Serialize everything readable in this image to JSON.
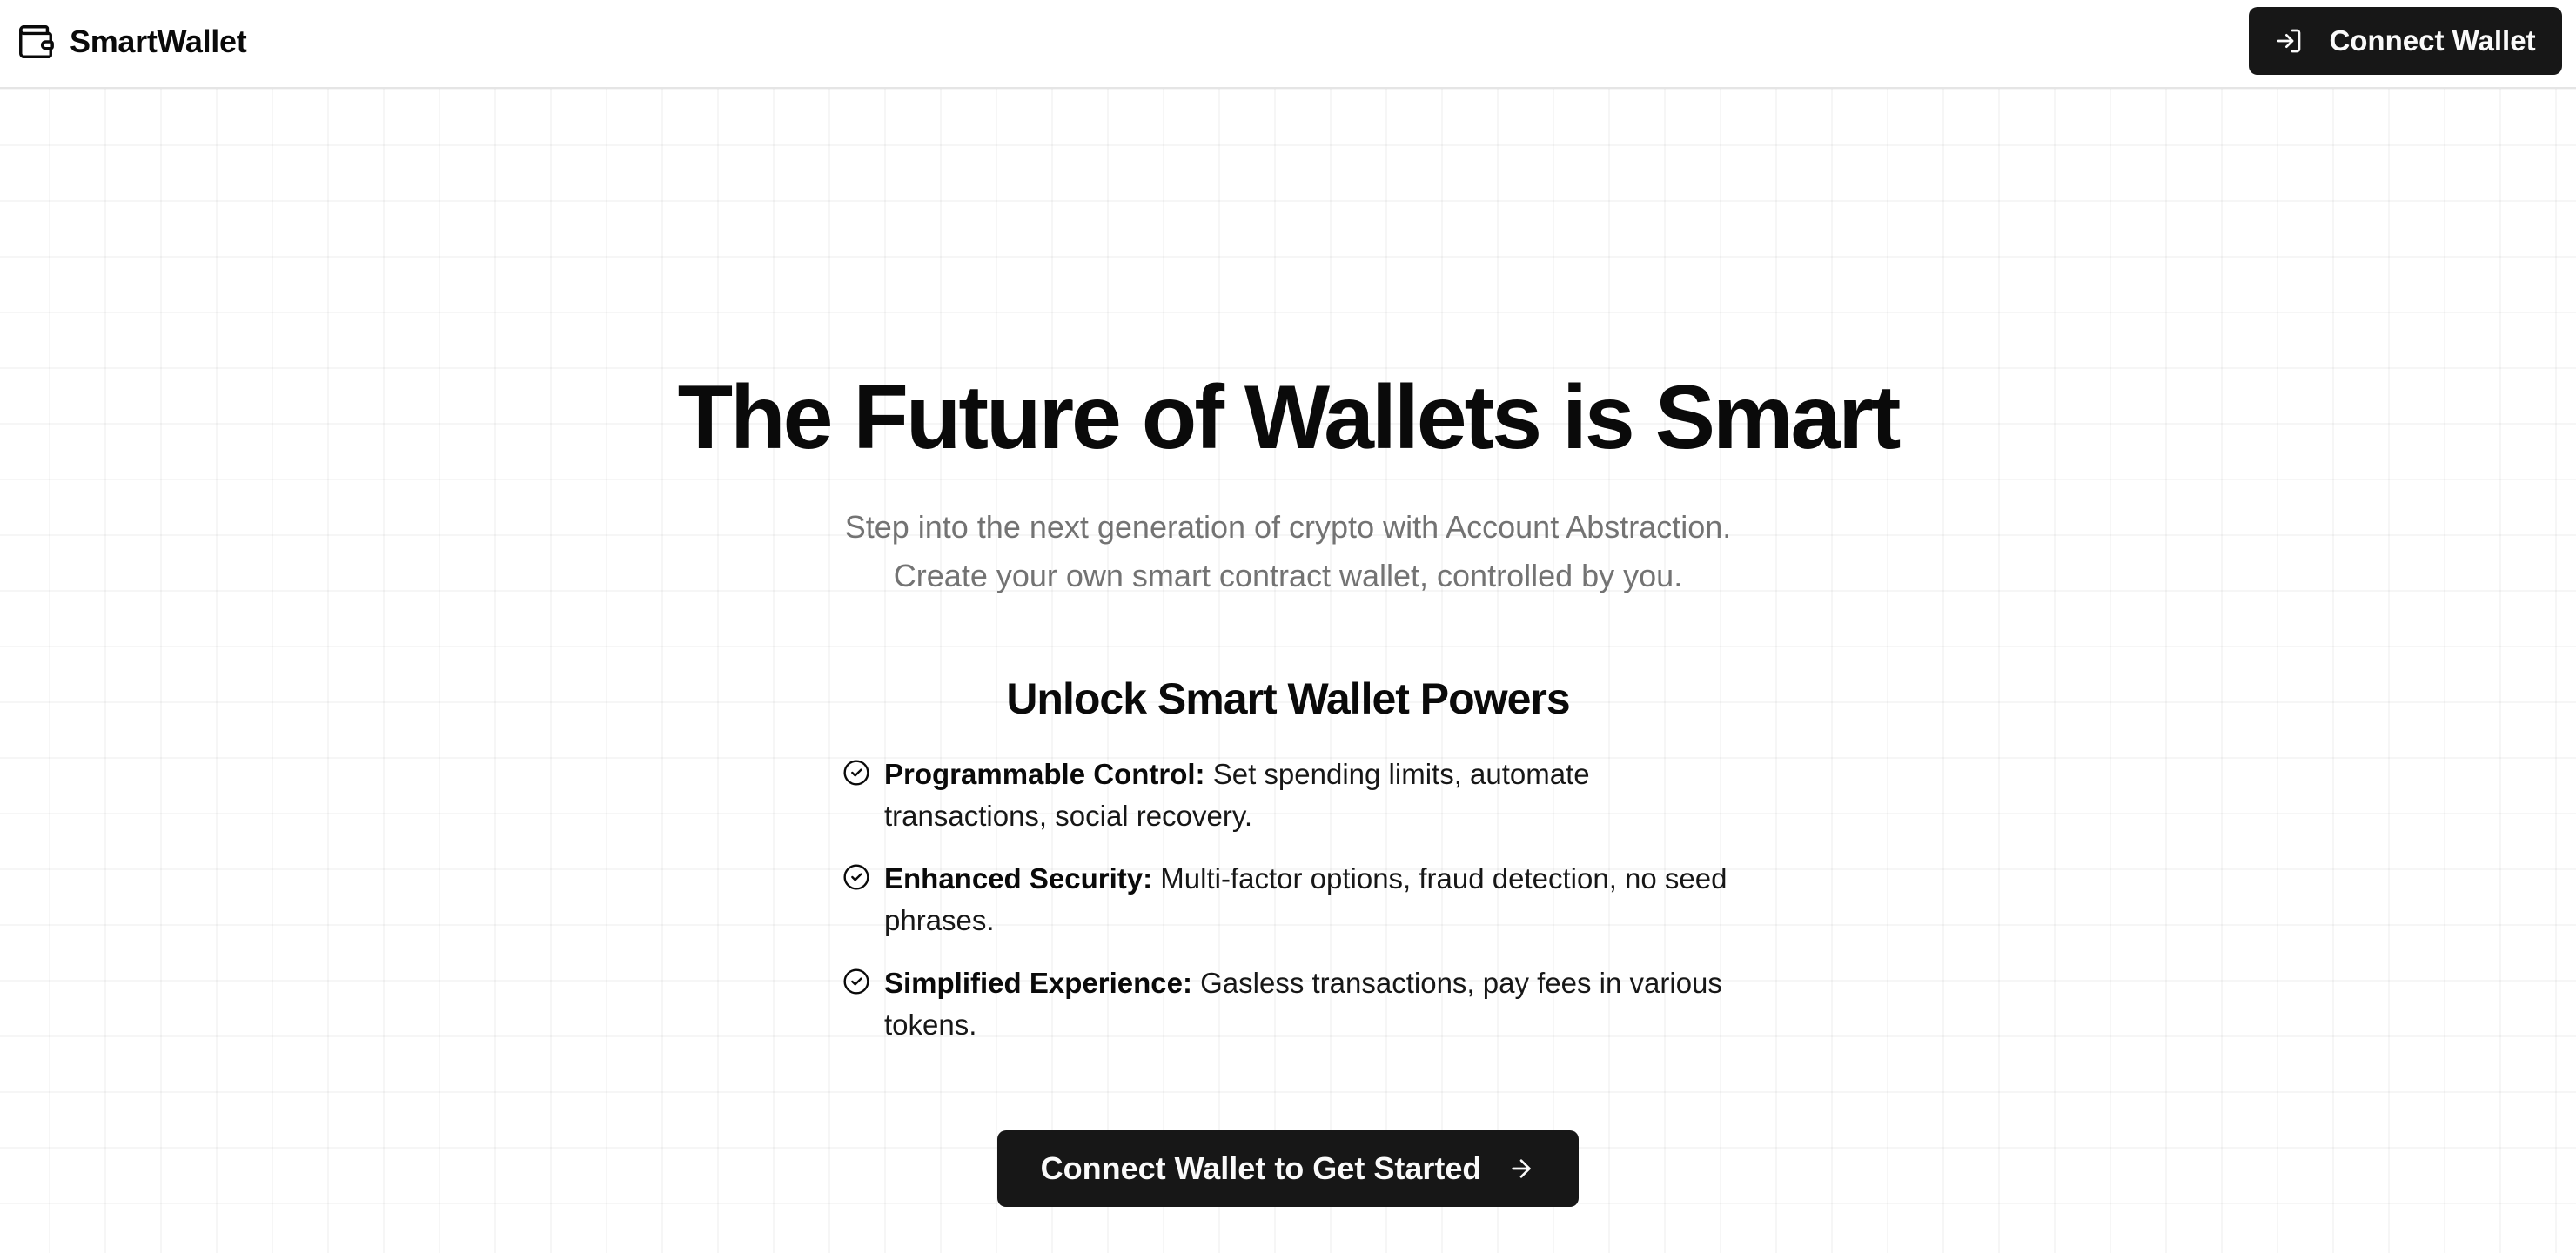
{
  "header": {
    "brand_name": "SmartWallet",
    "brand_icon": "wallet-icon",
    "connect_button": {
      "label": "Connect Wallet",
      "icon": "log-in-icon"
    }
  },
  "hero": {
    "title": "The Future of Wallets is Smart",
    "subtitle_lines": [
      "Step into the next generation of crypto with Account Abstraction.",
      "Create your own smart contract wallet, controlled by you."
    ]
  },
  "features": {
    "title": "Unlock Smart Wallet Powers",
    "check_icon": "check-circle-icon",
    "items": [
      {
        "label": "Programmable Control:",
        "text": "Set spending limits, automate transactions, social recovery."
      },
      {
        "label": "Enhanced Security:",
        "text": "Multi-factor options, fraud detection, no seed phrases."
      },
      {
        "label": "Simplified Experience:",
        "text": "Gasless transactions, pay fees in various tokens."
      }
    ]
  },
  "cta": {
    "label": "Connect Wallet to Get Started",
    "icon": "arrow-right-icon"
  },
  "colors": {
    "primary": "#171717",
    "primary_text": "#fafafa",
    "muted_text": "#737373",
    "border": "#e5e5e5",
    "background": "#ffffff"
  }
}
